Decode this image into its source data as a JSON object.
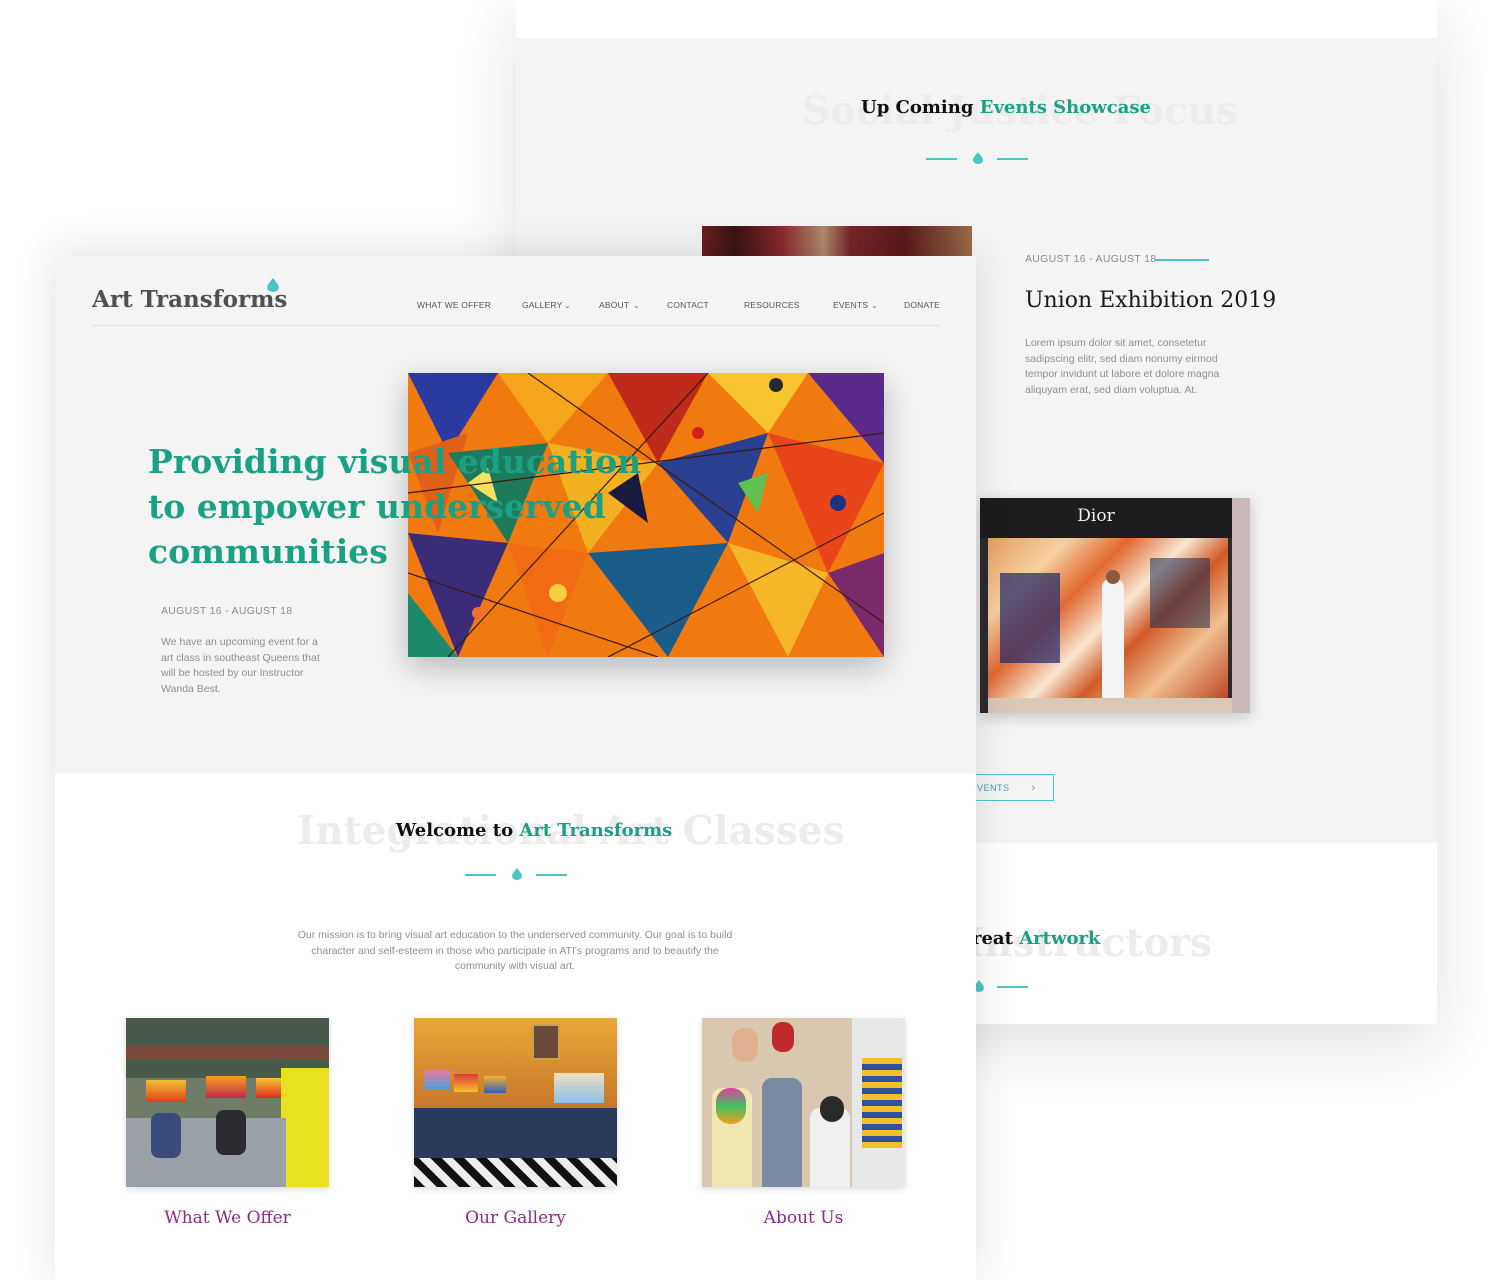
{
  "back_page": {
    "events_section": {
      "ghost_title": "Social Justice Focus",
      "heading_prefix": "Up Coming ",
      "heading_accent": "Events Showcase"
    },
    "event": {
      "date": "AUGUST 16 - AUGUST 18",
      "title": "Union Exhibition 2019",
      "description": "Lorem ipsum dolor sit amet, consetetur sadipscing elitr, sed diam nonumy eirmod tempor invidunt ut labore et dolore magna aliquyam erat, sed diam voluptua. At."
    },
    "store_sign": "Dior",
    "events_button_label": "VENTS",
    "instructors_section": {
      "ghost_title": "Instructors",
      "heading_prefix": "reat ",
      "heading_accent": "Artwork"
    }
  },
  "front_page": {
    "logo": "Art Transforms",
    "nav": [
      {
        "label": "WHAT WE OFFER",
        "dropdown": false
      },
      {
        "label": "GALLERY",
        "dropdown": true
      },
      {
        "label": "ABOUT",
        "dropdown": true
      },
      {
        "label": "CONTACT",
        "dropdown": false
      },
      {
        "label": "RESOURCES",
        "dropdown": false
      },
      {
        "label": "EVENTS",
        "dropdown": true
      },
      {
        "label": "DONATE",
        "dropdown": false
      }
    ],
    "hero": {
      "headline": "Providing visual education to empower underserved communities",
      "date": "AUGUST 16 - AUGUST 18",
      "text": "We have an upcoming event for a art class in southeast Queens that will be hosted by our Instructor Wanda Best."
    },
    "welcome": {
      "ghost_title": "Integrational Art Classes",
      "heading_prefix": "Welcome to ",
      "heading_accent": "Art Transforms",
      "mission": "Our mission is to bring visual art education to the underserved community. Our goal is to build character and self-esteem in those who participate in ATI's programs and to beautify the community with visual art."
    },
    "cards": [
      {
        "label": "What We Offer"
      },
      {
        "label": "Our Gallery"
      },
      {
        "label": "About Us"
      }
    ]
  },
  "colors": {
    "accent_green": "#1aa184",
    "accent_teal": "#4ec3c6",
    "card_label_purple": "#8b2a8d",
    "hero_background": "#f4f4f4"
  },
  "icons": [
    "leaf-drop-icon",
    "chevron-down-icon",
    "chevron-right-icon"
  ]
}
